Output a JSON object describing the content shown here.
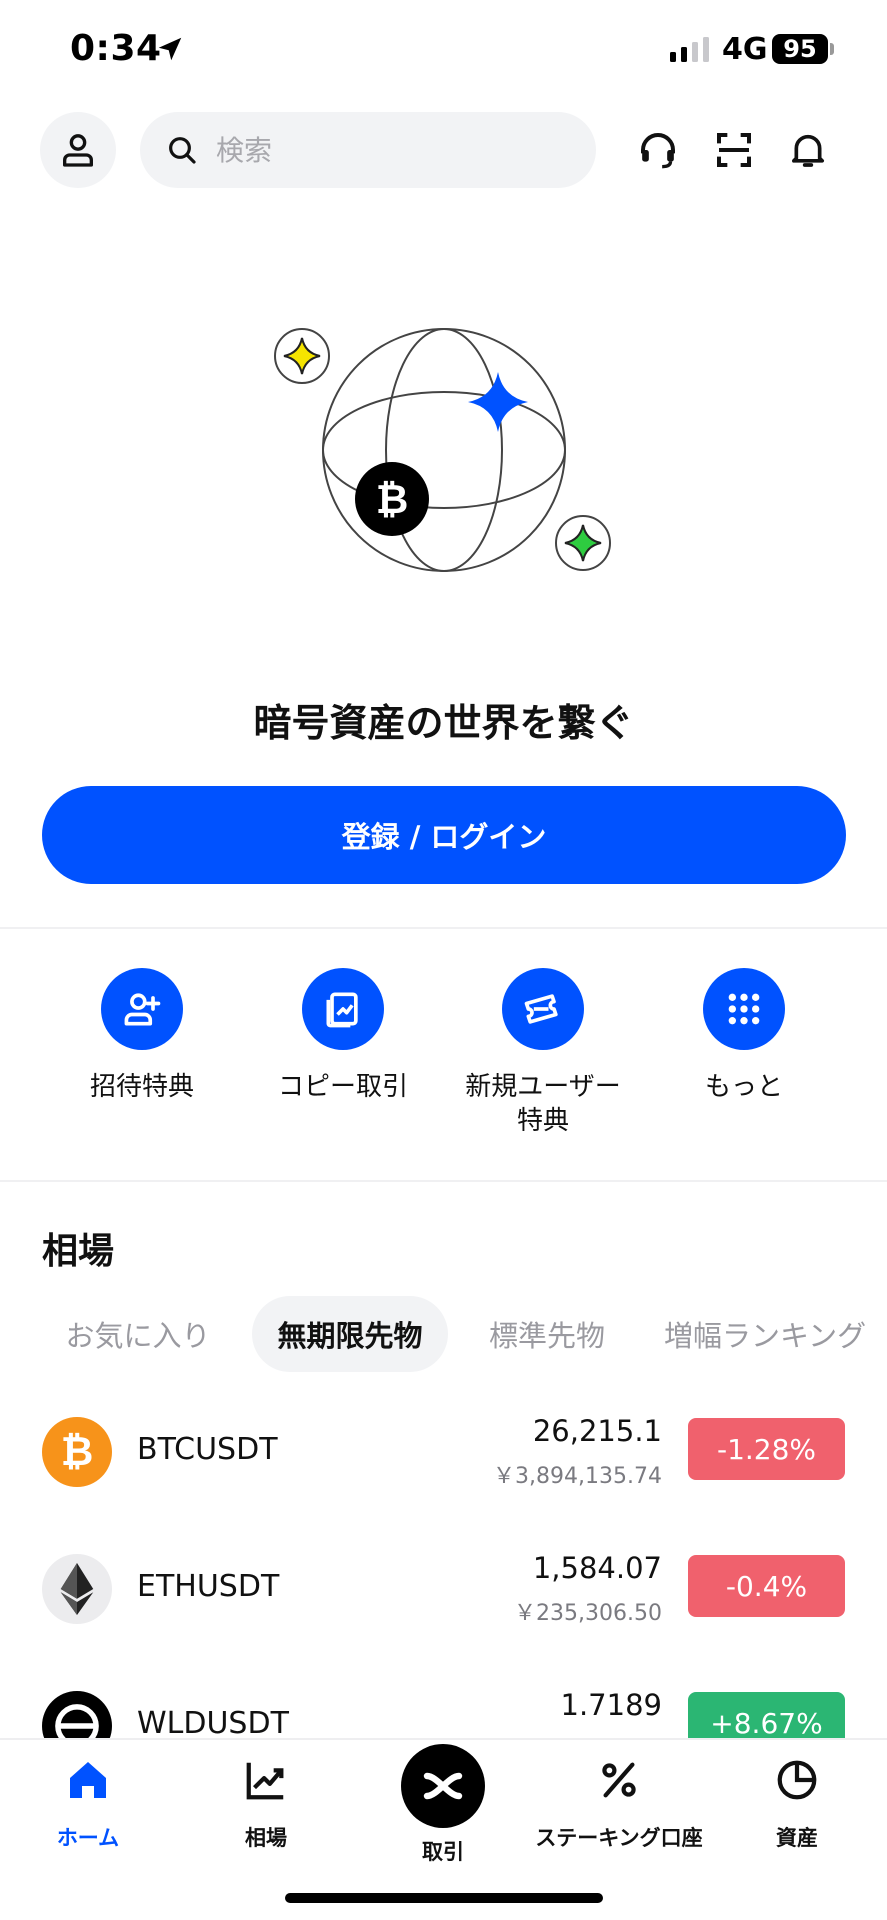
{
  "status_bar": {
    "time": "0:34",
    "network": "4G",
    "battery": "95"
  },
  "header": {
    "search_placeholder": "検索"
  },
  "hero": {
    "title": "暗号資産の世界を繋ぐ",
    "login_label": "登録 / ログイン"
  },
  "quick_actions": [
    {
      "label": "招待特典",
      "icon": "add-user-icon"
    },
    {
      "label": "コピー取引",
      "icon": "copy-trade-icon"
    },
    {
      "label": "新規ユーザー\n特典",
      "icon": "ticket-icon"
    },
    {
      "label": "もっと",
      "icon": "grid-dots-icon"
    }
  ],
  "market": {
    "title": "相場",
    "tabs": [
      "お気に入り",
      "無期限先物",
      "標準先物",
      "増幅ランキング"
    ],
    "active_tab": "無期限先物",
    "rows": [
      {
        "symbol": "BTCUSDT",
        "price": "26,215.1",
        "fiat": "￥3,894,135.74",
        "change": "-1.28%",
        "direction": "down"
      },
      {
        "symbol": "ETHUSDT",
        "price": "1,584.07",
        "fiat": "￥235,306.50",
        "change": "-0.4%",
        "direction": "down"
      },
      {
        "symbol": "WLDUSDT",
        "price": "1.7189",
        "fiat": "",
        "change": "+8.67%",
        "direction": "up"
      }
    ]
  },
  "nav": {
    "home": "ホーム",
    "market": "相場",
    "trade": "取引",
    "staking": "ステーキング口座",
    "assets": "資産"
  },
  "colors": {
    "accent": "#0052ff",
    "down": "#f0616d",
    "up": "#2bb673"
  }
}
